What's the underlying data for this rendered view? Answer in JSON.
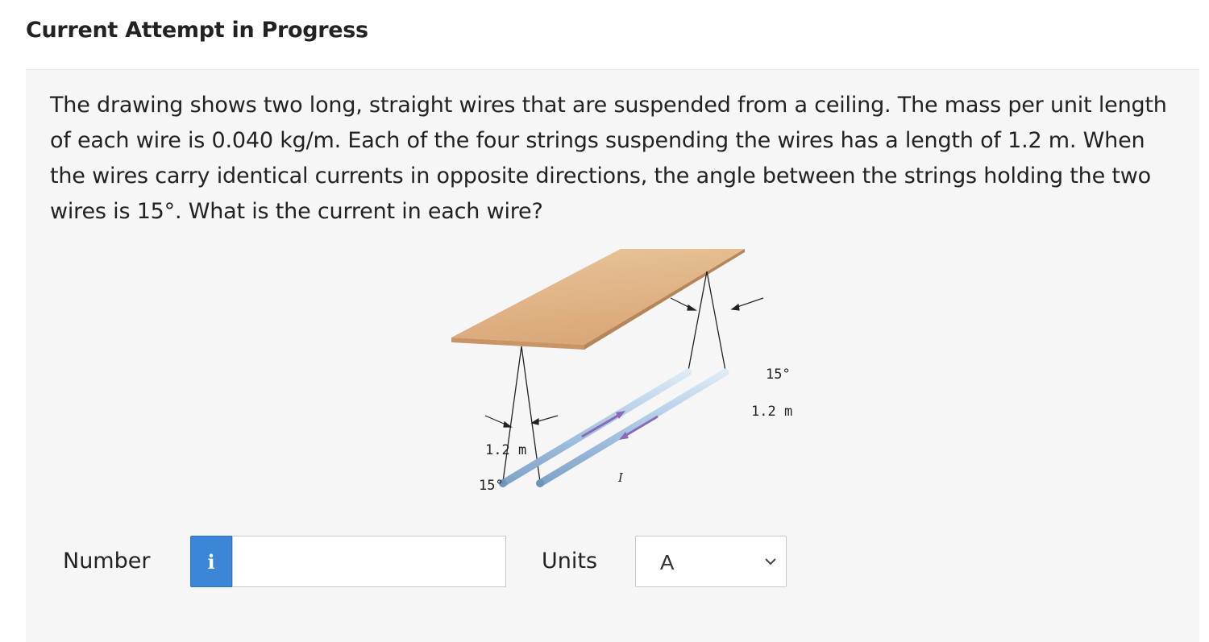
{
  "header": {
    "title": "Current Attempt in Progress"
  },
  "question": {
    "text": "The drawing shows two long, straight wires that are suspended from a ceiling. The mass per unit length of each wire is 0.040 kg/m. Each of the four strings suspending the wires has a length of 1.2 m. When the wires carry identical currents in opposite directions, the angle between the strings holding the two wires is 15°. What is the current in each wire?"
  },
  "figure": {
    "left_angle_label": "15°",
    "left_length_label": "1.2 m",
    "right_angle_label": "15°",
    "right_length_label": "1.2 m",
    "current_label_1": "I",
    "current_label_2": "I",
    "ceiling_color": "#e3b98a",
    "wire_color": "#a9c6e4",
    "arrow_color": "#8a6bb8"
  },
  "answer": {
    "number_label": "Number",
    "info_icon_glyph": "i",
    "number_value": "",
    "number_placeholder": "",
    "units_label": "Units",
    "units_selected": "A"
  },
  "colors": {
    "accent": "#3b86d6",
    "content_bg": "#f6f6f6"
  }
}
